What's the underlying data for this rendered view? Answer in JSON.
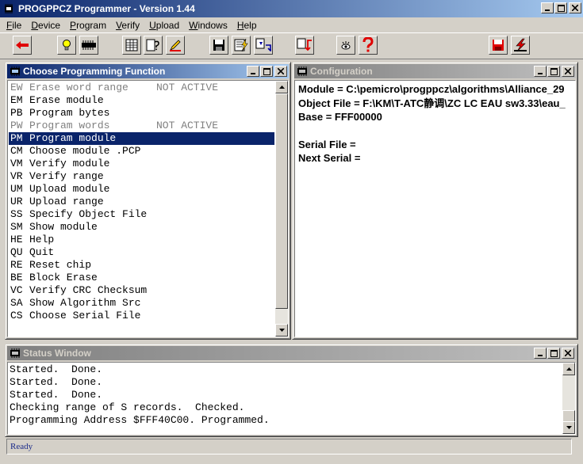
{
  "app": {
    "title": "PROGPPCZ Programmer - Version 1.44"
  },
  "menu": [
    {
      "label": "File",
      "u": "F",
      "rest": "ile"
    },
    {
      "label": "Device",
      "u": "D",
      "rest": "evice"
    },
    {
      "label": "Program",
      "u": "P",
      "rest": "rogram"
    },
    {
      "label": "Verify",
      "u": "V",
      "rest": "erify"
    },
    {
      "label": "Upload",
      "u": "U",
      "rest": "pload"
    },
    {
      "label": "Windows",
      "u": "W",
      "rest": "indows"
    },
    {
      "label": "Help",
      "u": "H",
      "rest": "elp"
    }
  ],
  "toolbar_icons": [
    "back-arrow-icon",
    "lightbulb-icon",
    "chip-icon",
    "grid-icon",
    "help-doc-icon",
    "pencil-icon",
    "save-icon",
    "lightning-doc-icon",
    "transfer-icon",
    "import-icon",
    "eye-icon",
    "question-icon",
    "save-red-icon",
    "lightning-red-icon"
  ],
  "function_window": {
    "title": "Choose Programming Function",
    "items": [
      {
        "code": "EW",
        "desc": "Erase word range",
        "note": "NOT ACTIVE",
        "state": "disabled"
      },
      {
        "code": "EM",
        "desc": "Erase module",
        "note": "",
        "state": "normal"
      },
      {
        "code": "PB",
        "desc": "Program bytes",
        "note": "",
        "state": "normal"
      },
      {
        "code": "PW",
        "desc": "Program words",
        "note": "NOT ACTIVE",
        "state": "disabled"
      },
      {
        "code": "PM",
        "desc": "Program module",
        "note": "",
        "state": "selected"
      },
      {
        "code": "CM",
        "desc": "Choose module .PCP",
        "note": "",
        "state": "normal"
      },
      {
        "code": "VM",
        "desc": "Verify module",
        "note": "",
        "state": "normal"
      },
      {
        "code": "VR",
        "desc": "Verify range",
        "note": "",
        "state": "normal"
      },
      {
        "code": "UM",
        "desc": "Upload module",
        "note": "",
        "state": "normal"
      },
      {
        "code": "UR",
        "desc": "Upload range",
        "note": "",
        "state": "normal"
      },
      {
        "code": "SS",
        "desc": "Specify Object File",
        "note": "",
        "state": "normal"
      },
      {
        "code": "SM",
        "desc": "Show module",
        "note": "",
        "state": "normal"
      },
      {
        "code": "HE",
        "desc": "Help",
        "note": "",
        "state": "normal"
      },
      {
        "code": "QU",
        "desc": "Quit",
        "note": "",
        "state": "normal"
      },
      {
        "code": "RE",
        "desc": "Reset chip",
        "note": "",
        "state": "normal"
      },
      {
        "code": "BE",
        "desc": "Block Erase",
        "note": "",
        "state": "normal"
      },
      {
        "code": "VC",
        "desc": "Verify CRC Checksum",
        "note": "",
        "state": "normal"
      },
      {
        "code": "SA",
        "desc": "Show Algorithm Src",
        "note": "",
        "state": "normal"
      },
      {
        "code": "CS",
        "desc": "Choose Serial File",
        "note": "",
        "state": "normal"
      }
    ]
  },
  "config_window": {
    "title": "Configuration",
    "lines": [
      "Module = C:\\pemicro\\progppcz\\algorithms\\Alliance_29",
      "Object File = F:\\KM\\T-ATC静调\\ZC LC EAU sw3.33\\eau_",
      "Base = FFF00000",
      "",
      "Serial File =",
      "Next Serial ="
    ]
  },
  "status_window": {
    "title": "Status Window",
    "lines": [
      "Started.  Done.",
      "Started.  Done.",
      "Started.  Done.",
      "Checking range of S records.  Checked.",
      "Programming Address $FFF40C00. Programmed."
    ]
  },
  "statusbar": {
    "text": "Ready"
  }
}
